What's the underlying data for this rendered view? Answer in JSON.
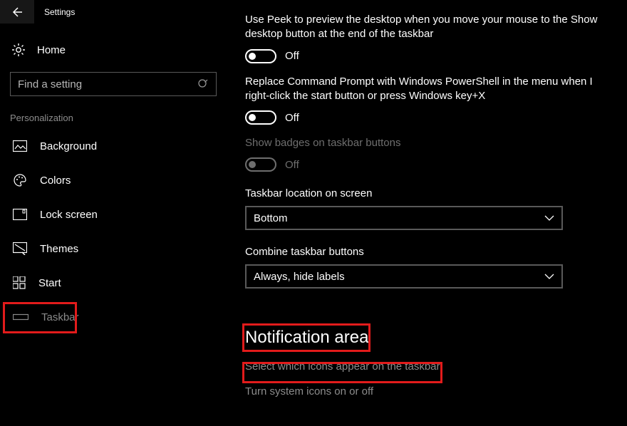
{
  "app": {
    "title": "Settings"
  },
  "home": {
    "label": "Home"
  },
  "search": {
    "placeholder": "Find a setting"
  },
  "section": {
    "title": "Personalization"
  },
  "nav": {
    "background": "Background",
    "colors": "Colors",
    "lockscreen": "Lock screen",
    "themes": "Themes",
    "start": "Start",
    "taskbar": "Taskbar"
  },
  "content": {
    "peek_text": "Use Peek to preview the desktop when you move your mouse to the Show desktop button at the end of the taskbar",
    "off1": "Off",
    "powershell_text": "Replace Command Prompt with Windows PowerShell in the menu when I right-click the start button or press Windows key+X",
    "off2": "Off",
    "badges_text": "Show badges on taskbar buttons",
    "off3": "Off",
    "location_label": "Taskbar location on screen",
    "location_value": "Bottom",
    "combine_label": "Combine taskbar buttons",
    "combine_value": "Always, hide labels",
    "notif_heading": "Notification area",
    "select_icons": "Select which icons appear on the taskbar",
    "system_icons": "Turn system icons on or off"
  }
}
